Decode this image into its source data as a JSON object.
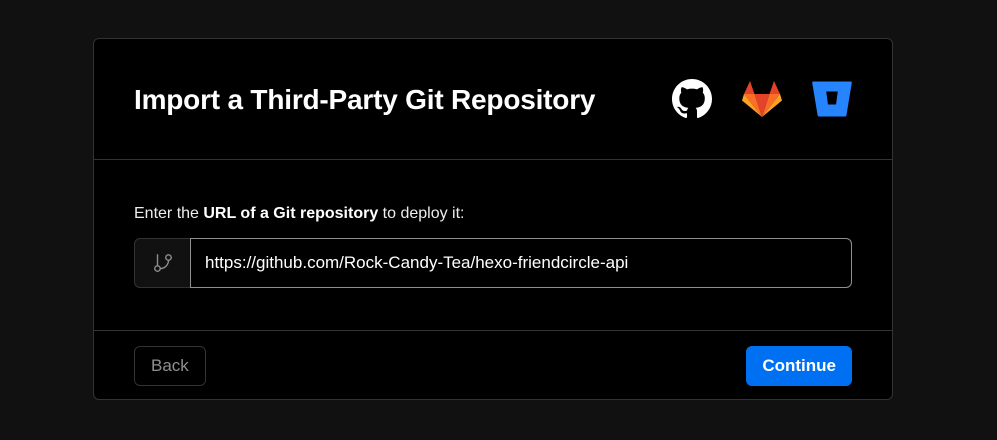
{
  "dialog": {
    "title": "Import a Third-Party Git Repository",
    "providers": [
      {
        "name": "GitHub",
        "icon": "github-icon"
      },
      {
        "name": "GitLab",
        "icon": "gitlab-icon"
      },
      {
        "name": "Bitbucket",
        "icon": "bitbucket-icon"
      }
    ]
  },
  "form": {
    "instruction_prefix": "Enter the ",
    "instruction_bold": "URL of a Git repository",
    "instruction_suffix": " to deploy it:",
    "prefix_icon": "git-branch-icon",
    "url_value": "https://github.com/Rock-Candy-Tea/hexo-friendcircle-api"
  },
  "footer": {
    "back_label": "Back",
    "continue_label": "Continue"
  },
  "colors": {
    "page_background": "#111111",
    "card_background": "#000000",
    "border": "#333333",
    "accent": "#0070f3",
    "gitlab_orange": "#e24329",
    "bitbucket_blue": "#0052cc"
  }
}
